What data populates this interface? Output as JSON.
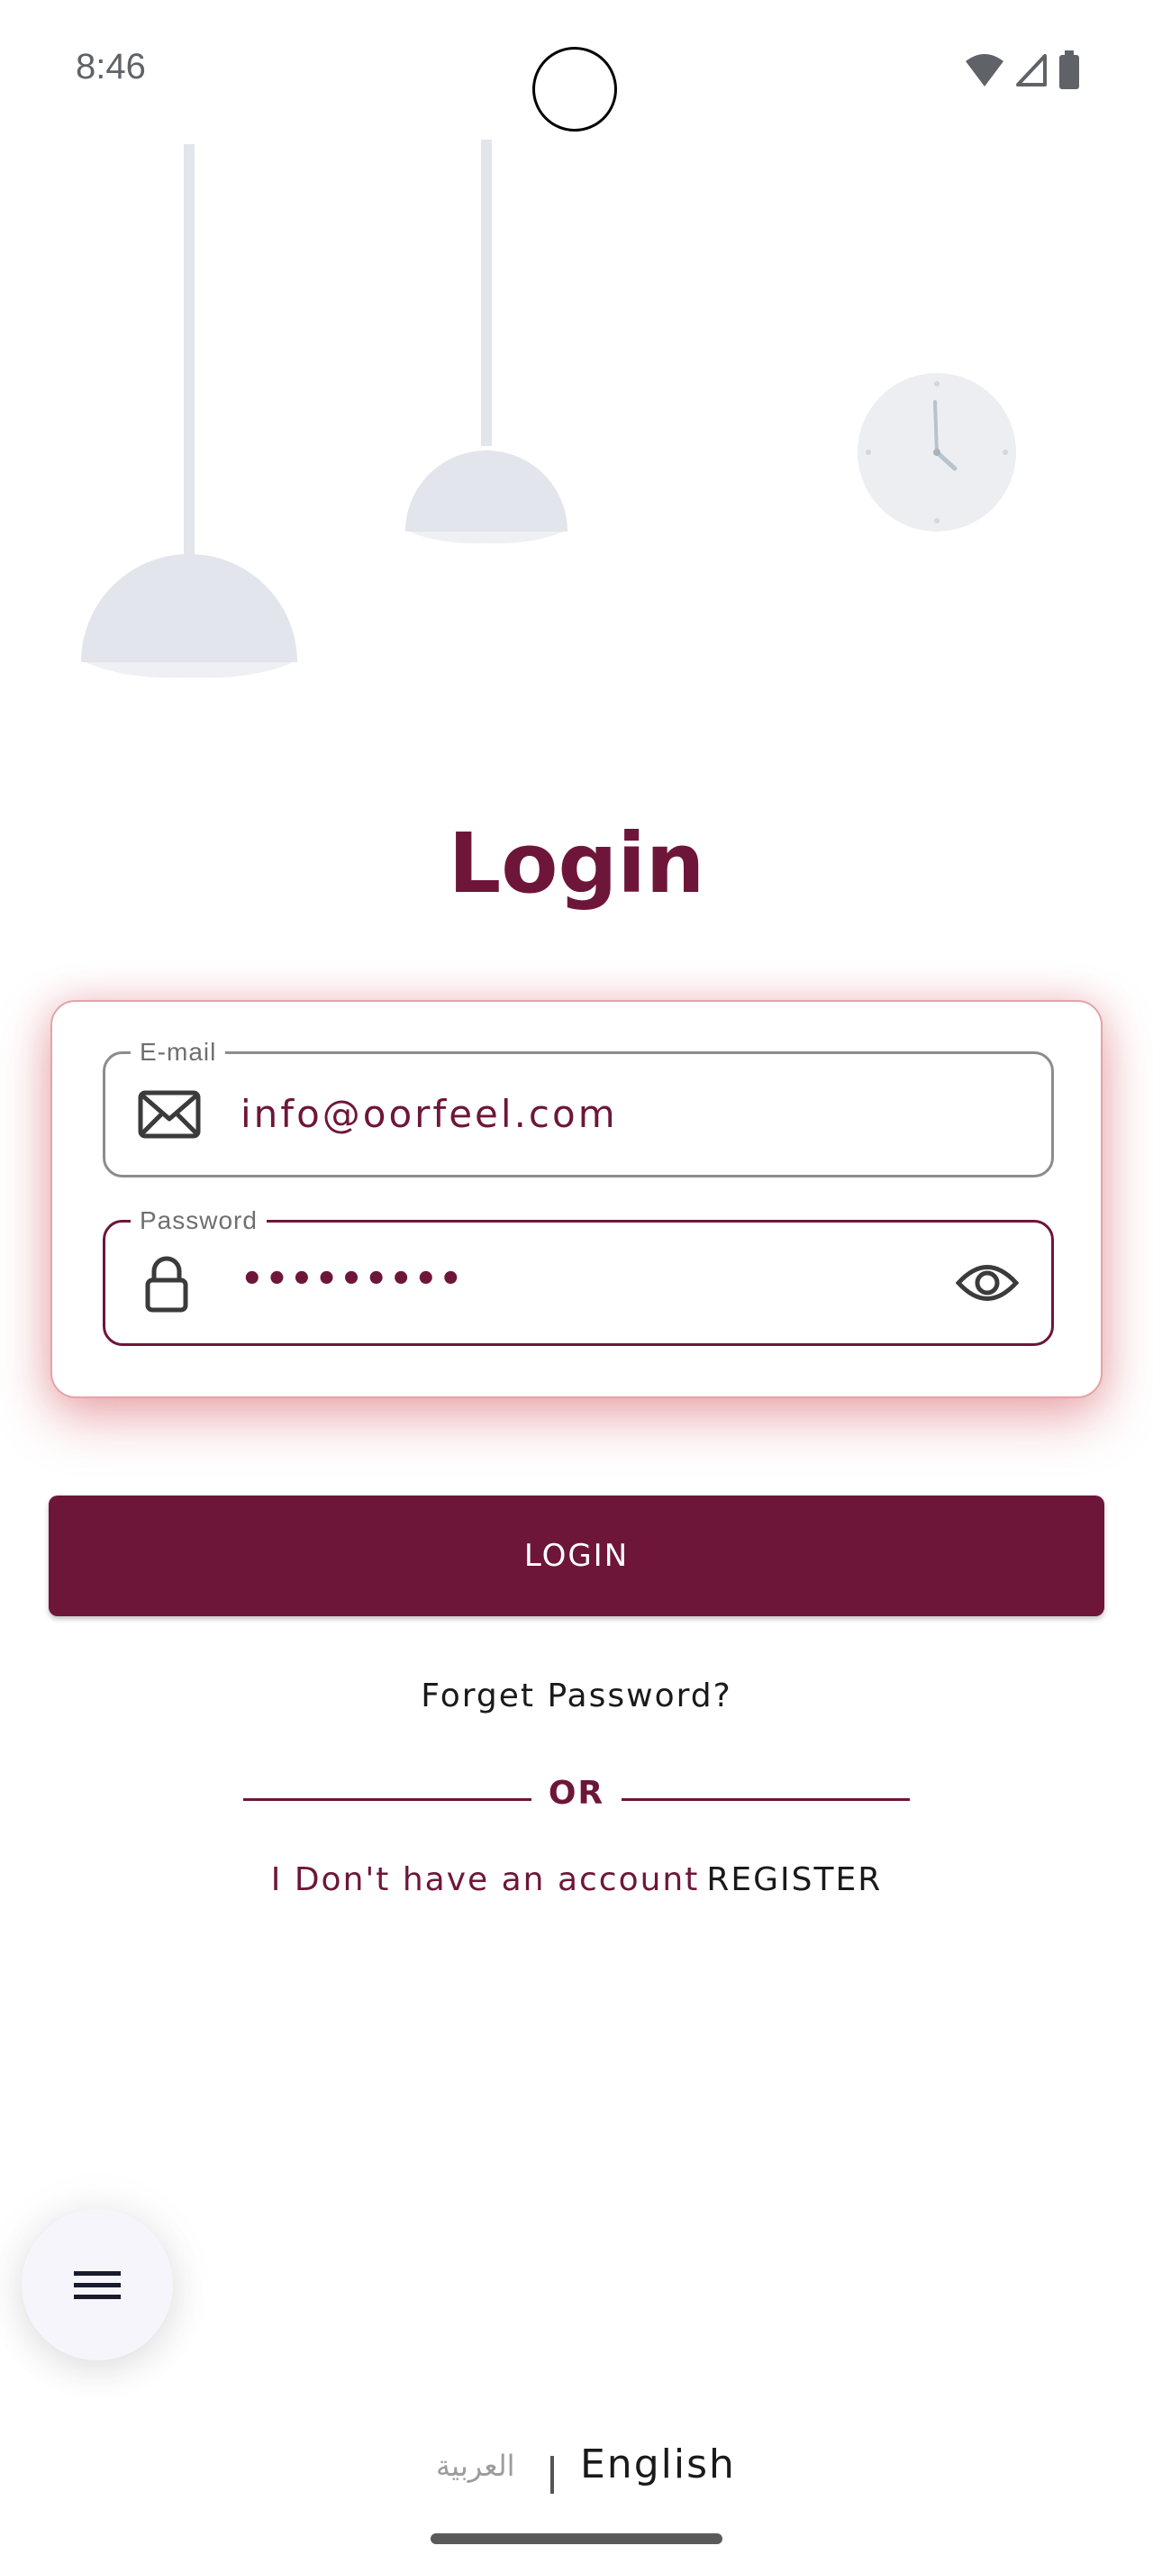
{
  "status_bar": {
    "time": "8:46",
    "icons": [
      "wifi-icon",
      "cell-signal-icon",
      "battery-icon"
    ]
  },
  "decoration": {
    "items": [
      "pendant-lamp-large",
      "pendant-lamp-small",
      "wall-clock"
    ]
  },
  "page": {
    "title": "Login"
  },
  "form": {
    "email": {
      "label": "E-mail",
      "value": "info@oorfeel.com",
      "icon": "mail-icon"
    },
    "password": {
      "label": "Password",
      "value": "•••••••••",
      "icon": "lock-icon",
      "toggle_icon": "eye-icon"
    }
  },
  "actions": {
    "login_label": "LOGIN",
    "forget_label": "Forget Password?",
    "or_label": "OR",
    "no_account_label": "I Don't have an account",
    "register_label": "REGISTER"
  },
  "fab": {
    "icon": "menu-icon"
  },
  "language": {
    "arabic_label": "العربية",
    "english_label": "English"
  },
  "colors": {
    "brand": "#6e1639",
    "card_glow": "#e3a4a8",
    "decor_gray": "#e2e5eb"
  }
}
